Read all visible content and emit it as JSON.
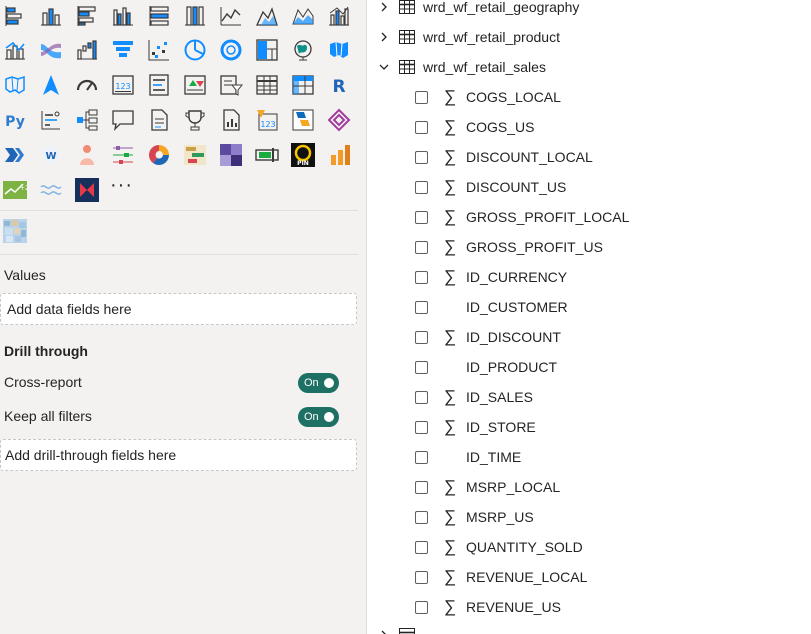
{
  "visualizations": {
    "icons": [
      "stacked-bar-icon",
      "stacked-column-icon",
      "clustered-bar-icon",
      "clustered-column-icon",
      "100-stacked-bar-icon",
      "100-stacked-column-icon",
      "line-chart-icon",
      "area-chart-icon",
      "stacked-area-icon",
      "line-clustered-column-icon",
      "line-stacked-column-icon",
      "ribbon-chart-icon",
      "waterfall-icon",
      "funnel-icon",
      "scatter-icon",
      "pie-icon",
      "donut-icon",
      "treemap-icon",
      "map-icon",
      "filled-map-icon",
      "shape-map-icon",
      "azure-map-icon",
      "gauge-icon",
      "card-icon",
      "multirow-card-icon",
      "kpi-icon",
      "slicer-icon",
      "table-icon",
      "matrix-icon",
      "r-visual-icon",
      "python-visual-icon",
      "key-influencers-icon",
      "decomposition-tree-icon",
      "qna-icon",
      "smart-narrative-icon",
      "metrics-icon",
      "paginated-report-icon",
      "power-apps-icon",
      "power-automate-icon",
      "custom-visual-diamond-icon",
      "chevron-visual-icon",
      "word-cloud-icon",
      "people-visual-icon",
      "timeline-visual-icon",
      "donut-custom-icon",
      "gantt-visual-icon",
      "purple-grid-icon",
      "bullet-chart-icon",
      "pin-visual-icon",
      "bar-orange-icon",
      "green-trend-icon",
      "wave-visual-icon",
      "navy-red-visual-icon"
    ],
    "more_label": "···",
    "custom_icon": "pixel-map-icon"
  },
  "wells": {
    "values_label": "Values",
    "values_placeholder": "Add data fields here",
    "drill_title": "Drill through",
    "cross_report_label": "Cross-report",
    "cross_report_state": "On",
    "keep_filters_label": "Keep all filters",
    "keep_filters_state": "On",
    "drill_placeholder": "Add drill-through fields here"
  },
  "fields": {
    "tables": [
      {
        "name": "wrd_wf_retail_geography",
        "expanded": false
      },
      {
        "name": "wrd_wf_retail_product",
        "expanded": false
      },
      {
        "name": "wrd_wf_retail_sales",
        "expanded": true
      }
    ],
    "sales_fields": [
      {
        "name": "COGS_LOCAL",
        "sigma": true
      },
      {
        "name": "COGS_US",
        "sigma": true
      },
      {
        "name": "DISCOUNT_LOCAL",
        "sigma": true
      },
      {
        "name": "DISCOUNT_US",
        "sigma": true
      },
      {
        "name": "GROSS_PROFIT_LOCAL",
        "sigma": true
      },
      {
        "name": "GROSS_PROFIT_US",
        "sigma": true
      },
      {
        "name": "ID_CURRENCY",
        "sigma": true
      },
      {
        "name": "ID_CUSTOMER",
        "sigma": false
      },
      {
        "name": "ID_DISCOUNT",
        "sigma": true
      },
      {
        "name": "ID_PRODUCT",
        "sigma": false
      },
      {
        "name": "ID_SALES",
        "sigma": true
      },
      {
        "name": "ID_STORE",
        "sigma": true
      },
      {
        "name": "ID_TIME",
        "sigma": false
      },
      {
        "name": "MSRP_LOCAL",
        "sigma": true
      },
      {
        "name": "MSRP_US",
        "sigma": true
      },
      {
        "name": "QUANTITY_SOLD",
        "sigma": true
      },
      {
        "name": "REVENUE_LOCAL",
        "sigma": true
      },
      {
        "name": "REVENUE_US",
        "sigma": true
      }
    ],
    "sigma_glyph": "∑"
  }
}
